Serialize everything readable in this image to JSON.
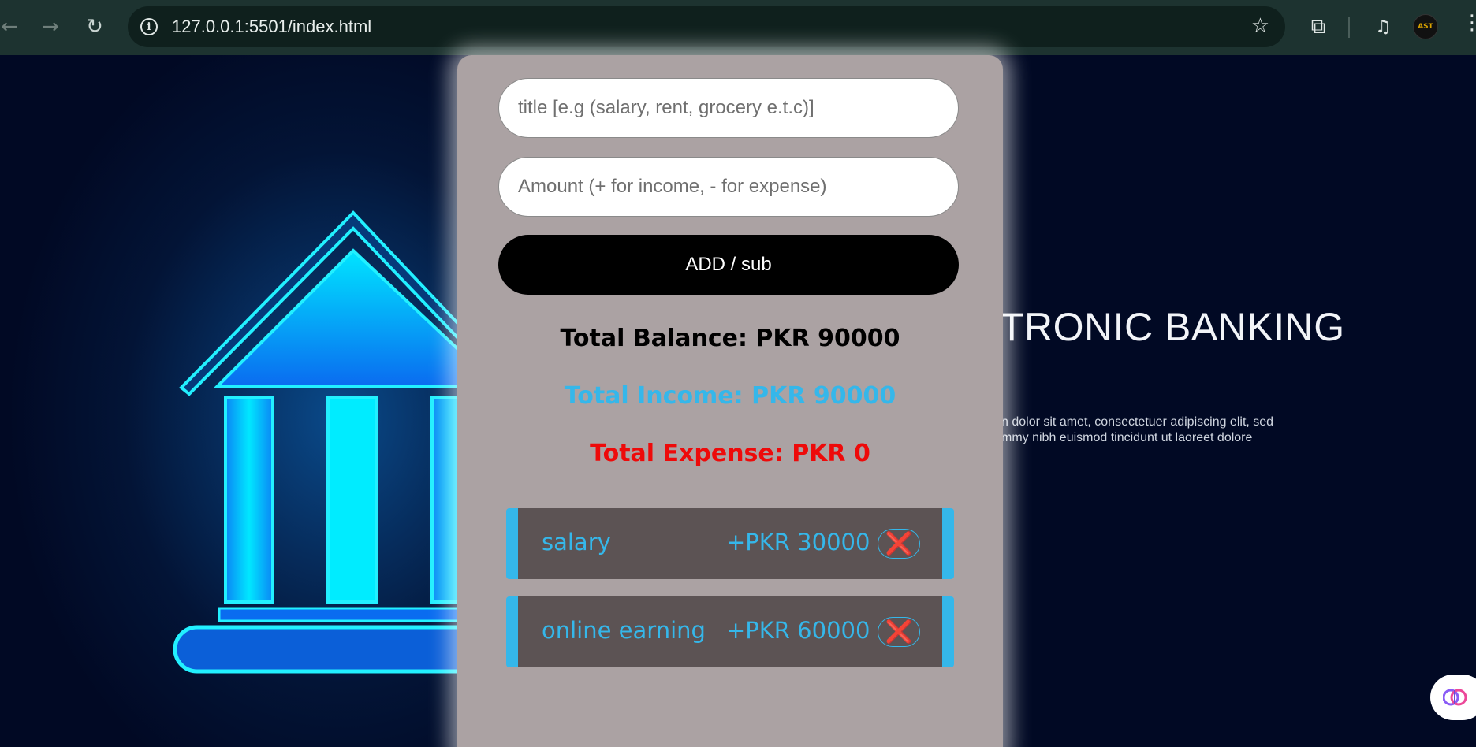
{
  "browser": {
    "url": "127.0.0.1:5501/index.html",
    "profile_initials": "AST"
  },
  "background": {
    "heading": "TRONIC BANKING",
    "subtext_line1": "n dolor sit amet, consectetuer adipiscing elit, sed",
    "subtext_line2": "mmy nibh euismod tincidunt ut laoreet dolore"
  },
  "form": {
    "title_placeholder": "title [e.g (salary, rent, grocery e.t.c)]",
    "amount_placeholder": "Amount (+ for income, - for expense)",
    "submit_label": "ADD / sub"
  },
  "totals": {
    "balance": "Total Balance: PKR 90000",
    "income": "Total Income: PKR 90000",
    "expense": "Total Expense: PKR 0"
  },
  "transactions": [
    {
      "title": "salary",
      "amount": "+PKR 30000",
      "delete_label": "❌"
    },
    {
      "title": "online earning",
      "amount": "+PKR 60000",
      "delete_label": "❌"
    }
  ],
  "colors": {
    "income": "#35b7ea",
    "expense": "#ee0a0a",
    "card": "#aba2a3",
    "item_bg": "#5c5354"
  }
}
